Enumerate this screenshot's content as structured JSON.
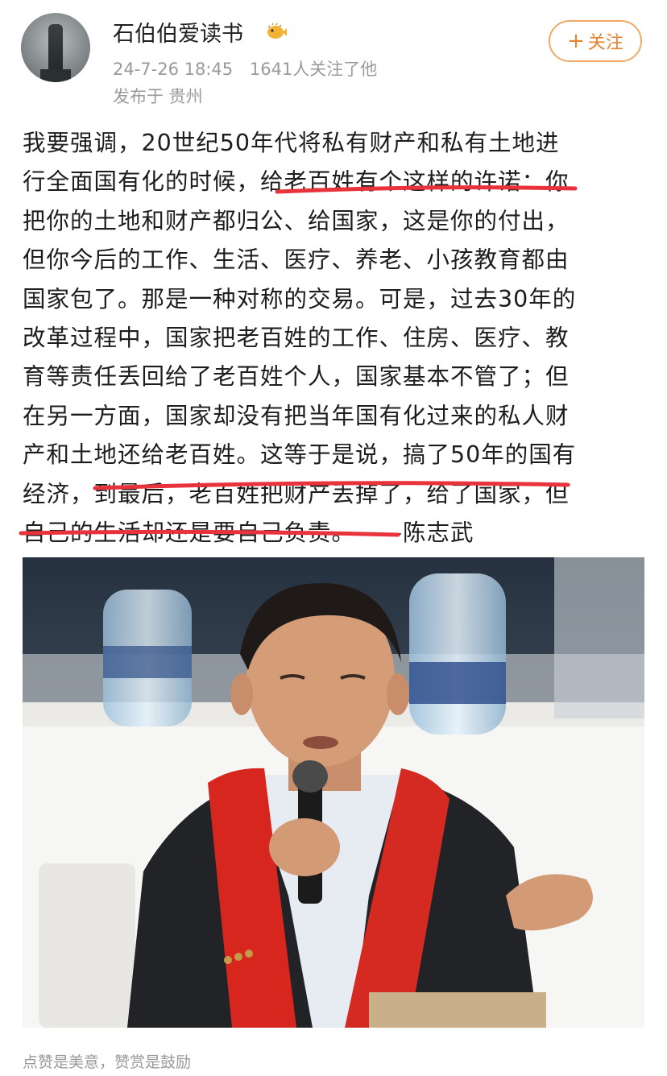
{
  "user": {
    "name": "石伯伯爱读书",
    "badge_icon": "pufferfish-badge-icon",
    "timestamp": "24-7-26 18:45",
    "followers": "1641人关注了他",
    "location": "发布于 贵州",
    "follow_label": "关注",
    "follow_plus": "+"
  },
  "post": {
    "lines": [
      "我要强调，20世纪50年代将私有财产和私有土地进",
      "行全面国有化的时候，给老百姓有个这样的许诺：你",
      "把你的土地和财产都归公、给国家，这是你的付出，",
      "但你今后的工作、生活、医疗、养老、小孩教育都由",
      "国家包了。那是一种对称的交易。可是，过去30年的",
      "改革过程中，国家把老百姓的工作、住房、医疗、教",
      "育等责任丢回给了老百姓个人，国家基本不管了；但",
      "在另一方面，国家却没有把当年国有化过来的私人财",
      "产和土地还给老百姓。这等于是说，搞了50年的国有",
      "经济，到最后，老百姓把财产丢掉了，给了国家，但",
      "自己的生活却还是要自己负责。——陈志武"
    ],
    "highlight_color": "#e8323c"
  },
  "photo": {
    "description_icon": "speaker-photo"
  },
  "footer": {
    "text": "点赞是美意，赞赏是鼓励"
  }
}
